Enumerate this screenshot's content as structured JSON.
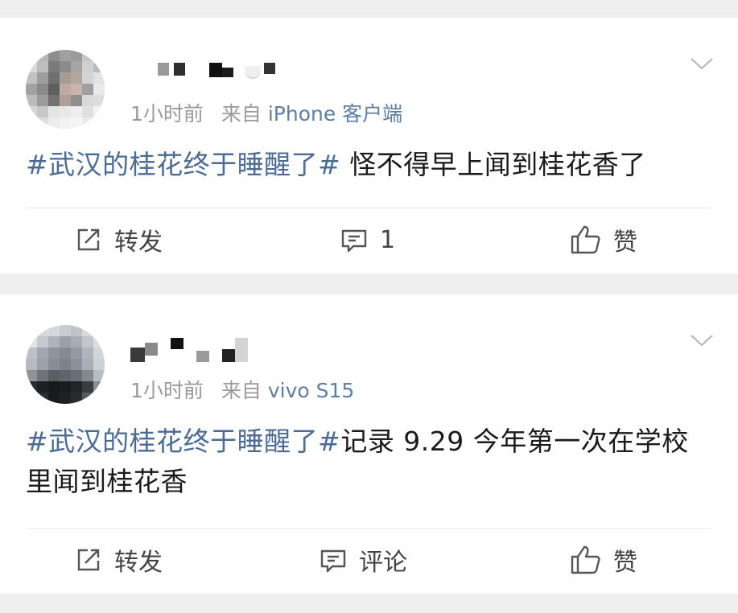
{
  "posts": [
    {
      "time": "1小时前",
      "source_prefix": "来自",
      "source": "iPhone 客户端",
      "topic": "#武汉的桂花终于睡醒了#",
      "text": " 怪不得早上闻到桂花香了",
      "actions": {
        "repost": "转发",
        "comment": "1",
        "like": "赞"
      }
    },
    {
      "time": "1小时前",
      "source_prefix": "来自",
      "source": "vivo S15",
      "topic": "#武汉的桂花终于睡醒了#",
      "text": "记录 9.29 今年第一次在学校里闻到桂花香",
      "actions": {
        "repost": "转发",
        "comment": "评论",
        "like": "赞"
      }
    }
  ],
  "colors": {
    "topic": "#4a6b98",
    "source": "#5c7fa6",
    "meta": "#9a9a9a",
    "background": "#efefef",
    "card": "#ffffff"
  },
  "icons": [
    "pixelated-avatar",
    "chevron-down-icon",
    "repost-icon",
    "comment-icon",
    "like-icon"
  ]
}
